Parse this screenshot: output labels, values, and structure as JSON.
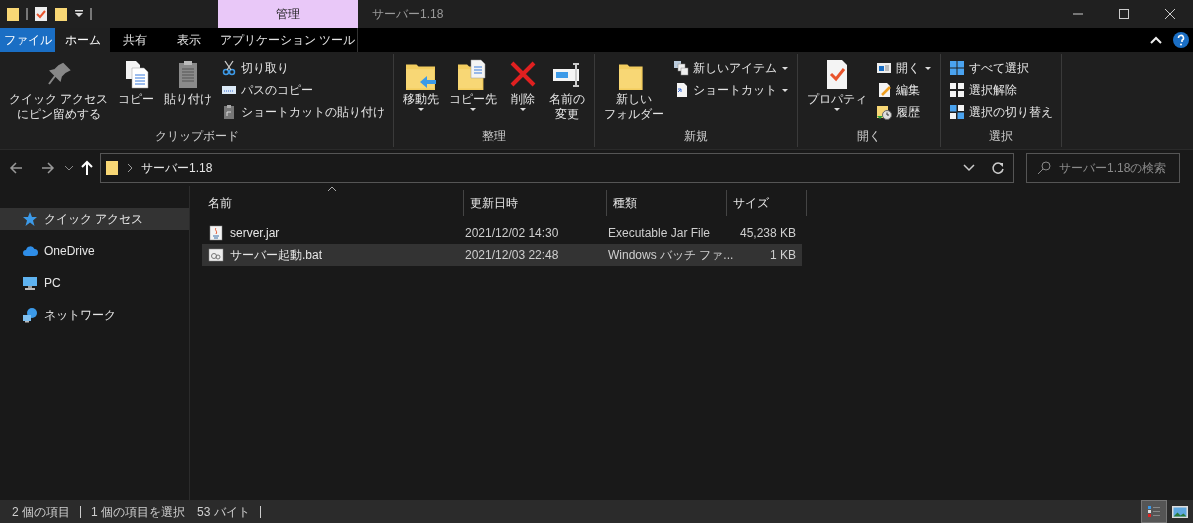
{
  "title_bar": {
    "context_tab": "管理",
    "title": "サーバー1.18"
  },
  "ribbon_tabs": [
    {
      "label": "ファイル",
      "kind": "file",
      "selected": false
    },
    {
      "label": "ホーム",
      "kind": "tab",
      "selected": true
    },
    {
      "label": "共有",
      "kind": "tab",
      "selected": false
    },
    {
      "label": "表示",
      "kind": "tab",
      "selected": false
    },
    {
      "label": "アプリケーション ツール",
      "kind": "context",
      "selected": false
    }
  ],
  "ribbon_groups": [
    {
      "label": "クリップボード",
      "commands": [
        {
          "label": "クイック アクセスにピン留めする",
          "kind": "large",
          "dropdown": false
        },
        {
          "label": "コピー",
          "kind": "large",
          "dropdown": false
        },
        {
          "label": "貼り付け",
          "kind": "large",
          "dropdown": false
        },
        {
          "label": "切り取り",
          "kind": "small",
          "dropdown": false
        },
        {
          "label": "パスのコピー",
          "kind": "small",
          "dropdown": false
        },
        {
          "label": "ショートカットの貼り付け",
          "kind": "small",
          "dropdown": false
        }
      ]
    },
    {
      "label": "整理",
      "commands": [
        {
          "label": "移動先",
          "kind": "large",
          "dropdown": true
        },
        {
          "label": "コピー先",
          "kind": "large",
          "dropdown": true
        },
        {
          "label": "削除",
          "kind": "large",
          "dropdown": true
        },
        {
          "label": "名前の変更",
          "kind": "large",
          "dropdown": false
        }
      ]
    },
    {
      "label": "新規",
      "commands": [
        {
          "label": "新しいフォルダー",
          "kind": "large",
          "dropdown": false
        },
        {
          "label": "新しいアイテム",
          "kind": "small",
          "dropdown": true
        },
        {
          "label": "ショートカット",
          "kind": "small",
          "dropdown": true
        }
      ]
    },
    {
      "label": "開く",
      "commands": [
        {
          "label": "プロパティ",
          "kind": "large",
          "dropdown": true
        },
        {
          "label": "開く",
          "kind": "small",
          "dropdown": true
        },
        {
          "label": "編集",
          "kind": "small",
          "dropdown": false
        },
        {
          "label": "履歴",
          "kind": "small",
          "dropdown": false
        }
      ]
    },
    {
      "label": "選択",
      "commands": [
        {
          "label": "すべて選択",
          "kind": "small",
          "dropdown": false
        },
        {
          "label": "選択解除",
          "kind": "small",
          "dropdown": false
        },
        {
          "label": "選択の切り替え",
          "kind": "small",
          "dropdown": false
        }
      ]
    }
  ],
  "address_bar": {
    "breadcrumb": [
      "サーバー1.18"
    ]
  },
  "search": {
    "placeholder": "サーバー1.18の検索"
  },
  "nav_pane": {
    "items": [
      {
        "label": "クイック アクセス",
        "selected": true
      },
      {
        "label": "OneDrive",
        "selected": false
      },
      {
        "label": "PC",
        "selected": false
      },
      {
        "label": "ネットワーク",
        "selected": false
      }
    ]
  },
  "file_list": {
    "columns": [
      {
        "label": "名前",
        "sorted": true
      },
      {
        "label": "更新日時",
        "sorted": false
      },
      {
        "label": "種類",
        "sorted": false
      },
      {
        "label": "サイズ",
        "sorted": false
      }
    ],
    "rows": [
      {
        "name": "server.jar",
        "modified": "2021/12/02 14:30",
        "type": "Executable Jar File",
        "size": "45,238 KB",
        "selected": false
      },
      {
        "name": "サーバー起動.bat",
        "modified": "2021/12/03 22:48",
        "type": "Windows バッチ ファ...",
        "size": "1 KB",
        "selected": true
      }
    ]
  },
  "status_bar": {
    "item_count": "2 個の項目",
    "selection": "1 個の項目を選択",
    "selection_size": "53 バイト",
    "view_buttons": [
      {
        "selected": true
      },
      {
        "selected": false
      }
    ]
  }
}
